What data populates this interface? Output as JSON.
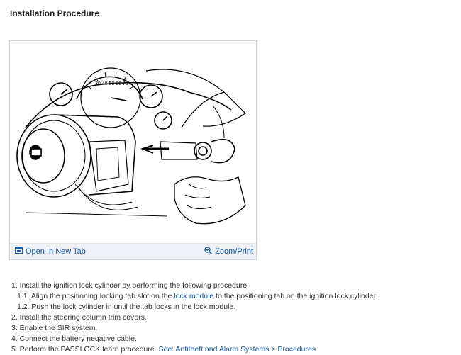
{
  "heading": "Installation Procedure",
  "figure": {
    "open_tab_label": "Open In New Tab",
    "zoom_label": "Zoom/Print",
    "open_tab_icon": "open-tab-icon",
    "zoom_icon": "magnifier-icon"
  },
  "steps": {
    "s1": "1. Install the ignition lock cylinder by performing the following procedure:",
    "s1_1_pre": "1.1. Align the positioning locking tab slot on the ",
    "s1_1_link": "lock module",
    "s1_1_post": " to the positioning tab on the ignition lock cylinder.",
    "s1_2": "1.2. Push the lock cylinder in until the tab locks in the lock module.",
    "s2": "2. Install the steering column trim covers.",
    "s3": "3. Enable the SIR system.",
    "s4": "4. Connect the battery negative cable.",
    "s5_pre": "5. Perform the PASSLOCK learn procedure. ",
    "s5_link": "See: Antitheft and Alarm Systems > Procedures"
  }
}
